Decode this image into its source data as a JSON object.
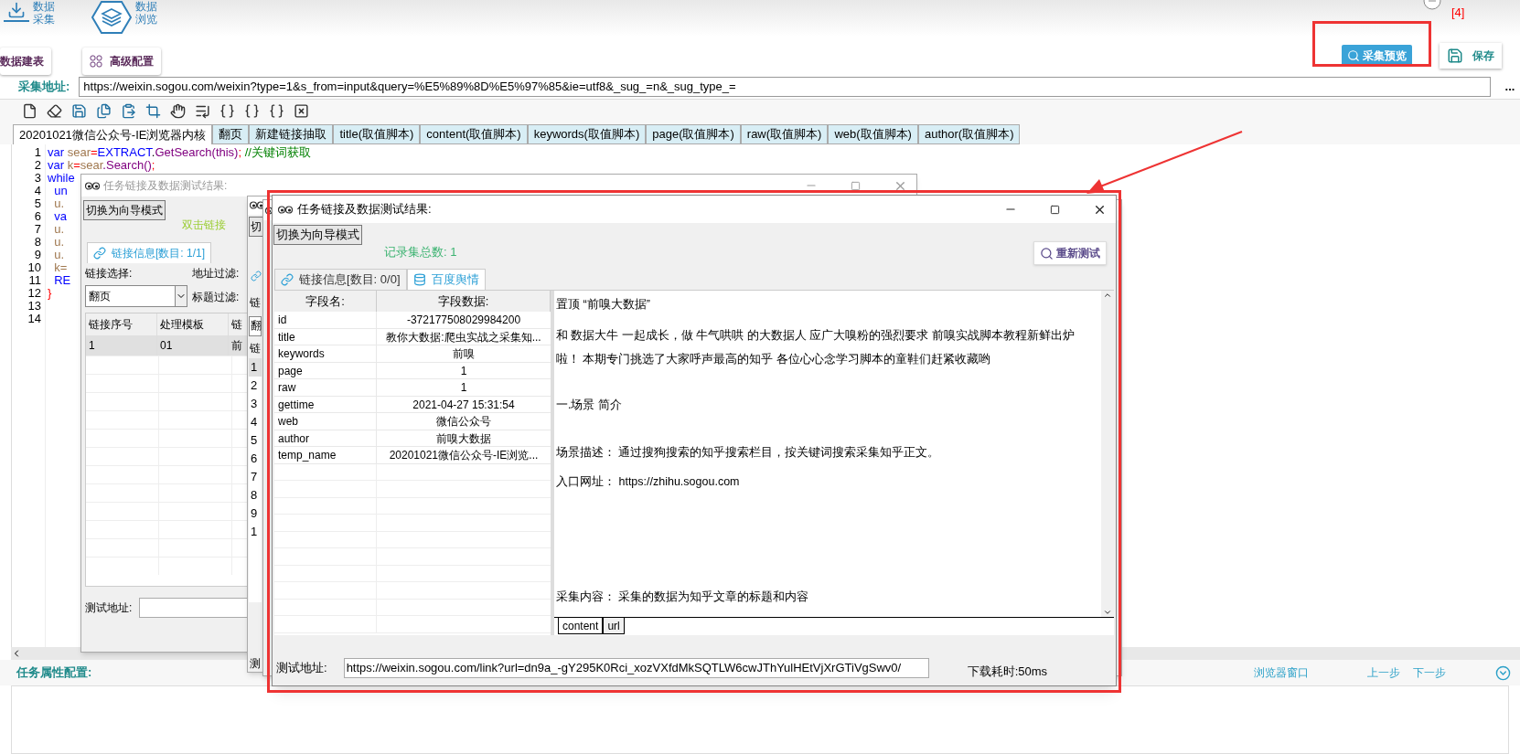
{
  "nav": [
    {
      "lines": [
        "数据",
        "采集"
      ],
      "kind": "download"
    },
    {
      "lines": [
        "数据",
        "浏览"
      ],
      "kind": "layers"
    }
  ],
  "top_buttons": [
    {
      "label": "数据建表",
      "kind": "plain"
    },
    {
      "label": "高级配置",
      "kind": "grid"
    }
  ],
  "preview_button": "采集预览",
  "save_button": "保存",
  "annotation": "[4]",
  "url_bar": {
    "label": "采集地址:",
    "value": "https://weixin.sogou.com/weixin?type=1&s_from=input&query=%E5%89%8D%E5%97%85&ie=utf8&_sug_=n&_sug_type_=",
    "more": "..."
  },
  "edit_tools": [
    {
      "kind": "file"
    },
    {
      "kind": "eraser"
    },
    {
      "kind": "save"
    },
    {
      "kind": "copy"
    },
    {
      "kind": "paste"
    },
    {
      "kind": "crop"
    },
    {
      "kind": "hand"
    },
    {
      "kind": "list"
    },
    {
      "kind": "braces"
    },
    {
      "kind": "braces"
    },
    {
      "kind": "braces"
    },
    {
      "kind": "close"
    }
  ],
  "editor_tabs": [
    {
      "label": "20201021微信公众号-IE浏览器内核",
      "selected": true
    },
    {
      "label": "翻页",
      "selected": false
    },
    {
      "label": "新建链接抽取",
      "selected": false
    },
    {
      "label": "title(取值脚本)",
      "selected": false
    },
    {
      "label": "content(取值脚本)",
      "selected": false
    },
    {
      "label": "keywords(取值脚本)",
      "selected": false
    },
    {
      "label": "page(取值脚本)",
      "selected": false
    },
    {
      "label": "raw(取值脚本)",
      "selected": false
    },
    {
      "label": "web(取值脚本)",
      "selected": false
    },
    {
      "label": "author(取值脚本)",
      "selected": false
    }
  ],
  "code_lines": [
    {
      "number": "1",
      "tokens": [
        {
          "text": "var",
          "kind": "keyword"
        },
        {
          "text": " sear",
          "kind": "ident"
        },
        {
          "text": "=",
          "kind": "op"
        },
        {
          "text": "EXTRACT",
          "kind": "keyword"
        },
        {
          "text": ".",
          "kind": "plain"
        },
        {
          "text": "GetSearch(this)",
          "kind": "method"
        },
        {
          "text": ";",
          "kind": "op"
        },
        {
          "text": " //关键词获取",
          "kind": "comment"
        }
      ]
    },
    {
      "number": "2",
      "tokens": [
        {
          "text": "var",
          "kind": "keyword"
        },
        {
          "text": " k",
          "kind": "ident"
        },
        {
          "text": "=",
          "kind": "op"
        },
        {
          "text": "sear",
          "kind": "ident"
        },
        {
          "text": ".Search()",
          "kind": "method"
        },
        {
          "text": ";",
          "kind": "op"
        }
      ]
    },
    {
      "number": "3",
      "tokens": [
        {
          "text": "while",
          "kind": "keyword"
        }
      ]
    },
    {
      "number": "4",
      "tokens": [
        {
          "text": "  un",
          "kind": "keyword"
        }
      ]
    },
    {
      "number": "5",
      "tokens": [
        {
          "text": "  u.",
          "kind": "ident"
        }
      ]
    },
    {
      "number": "6",
      "tokens": [
        {
          "text": "  va",
          "kind": "keyword"
        }
      ]
    },
    {
      "number": "7",
      "tokens": [
        {
          "text": "  u.",
          "kind": "ident"
        }
      ]
    },
    {
      "number": "8",
      "tokens": [
        {
          "text": "  u.",
          "kind": "ident"
        }
      ]
    },
    {
      "number": "9",
      "tokens": [
        {
          "text": "  u.",
          "kind": "ident"
        }
      ]
    },
    {
      "number": "10",
      "tokens": [
        {
          "text": "  k=",
          "kind": "ident"
        }
      ]
    },
    {
      "number": "11",
      "tokens": [
        {
          "text": "  RE",
          "kind": "keyword"
        }
      ]
    },
    {
      "number": "12",
      "tokens": [
        {
          "text": "}",
          "kind": "op"
        }
      ]
    },
    {
      "number": "13"
    },
    {
      "number": "14"
    }
  ],
  "dialog_back": {
    "title": "任务链接及数据测试结果:",
    "mode_button": "切换为向导模式",
    "hint": "双击链接",
    "tab": "链接信息[数目: 1/1]",
    "link_select_label": "链接选择:",
    "url_filter_label": "地址过滤:",
    "select_value": "翻页",
    "title_filter_label": "标题过滤:",
    "columns": [
      "链接序号",
      "处理模板",
      "链"
    ],
    "rows": [
      {
        "cells": [
          "1",
          "01",
          "前"
        ],
        "selected": true
      }
    ],
    "test_url_label": "测试地址:"
  },
  "dialog_middle": {
    "button": "切",
    "label": "链",
    "select": "翻",
    "header": "链",
    "rows": [
      "1",
      "2",
      "3",
      "4",
      "5",
      "6",
      "7",
      "8",
      "9",
      "1"
    ],
    "test_label": "测"
  },
  "dialog_front": {
    "title": "任务链接及数据测试结果:",
    "mode_button": "切换为向导模式",
    "record_count": "记录集总数: 1",
    "retest_button": "重新测试",
    "tabs": [
      {
        "label": "链接信息[数目: 0/0]",
        "kind": "link",
        "selected": false
      },
      {
        "label": "百度舆情",
        "kind": "database",
        "selected": true
      }
    ],
    "columns": [
      "字段名:",
      "字段数据:"
    ],
    "fields": [
      {
        "name": "id",
        "value": "-372177508029984200"
      },
      {
        "name": "title",
        "value": "教你大数据:爬虫实战之采集知..."
      },
      {
        "name": "keywords",
        "value": "前嗅"
      },
      {
        "name": "page",
        "value": "1"
      },
      {
        "name": "raw",
        "value": "1"
      },
      {
        "name": "gettime",
        "value": "2021-04-27 15:31:54"
      },
      {
        "name": "web",
        "value": "微信公众号"
      },
      {
        "name": "author",
        "value": "前嗅大数据"
      },
      {
        "name": "temp_name",
        "value": "20201021微信公众号-IE浏览..."
      }
    ],
    "content_lines": [
      "置顶 “前嗅大数据”",
      "和 数据大牛 一起成长，做 牛气哄哄 的大数据人 应广大嗅粉的强烈要求 前嗅实战脚本教程新鲜出炉",
      "啦！ 本期专门挑选了大家呼声最高的知乎 各位心心念学习脚本的童鞋们赶紧收藏哟",
      "一.场景 简介",
      "场景描述： 通过搜狗搜索的知乎搜索栏目，按关键词搜索采集知乎正文。",
      "入口网址： https://zhihu.sogou.com",
      "采集内容： 采集的数据为知乎文章的标题和内容"
    ],
    "content_tabs": [
      {
        "label": "content",
        "selected": true
      },
      {
        "label": "url",
        "selected": false
      }
    ],
    "test_url_label": "测试地址:",
    "test_url": "https://weixin.sogou.com/link?url=dn9a_-gY295K0Rci_xozVXfdMkSQTLW6cwJThYulHEtVjXrGTiVgSwv0/",
    "timing": "下载耗时:50ms"
  },
  "footer": {
    "label": "任务属性配置:",
    "links": [
      "浏览器窗口",
      "上一步",
      "下一步"
    ]
  }
}
